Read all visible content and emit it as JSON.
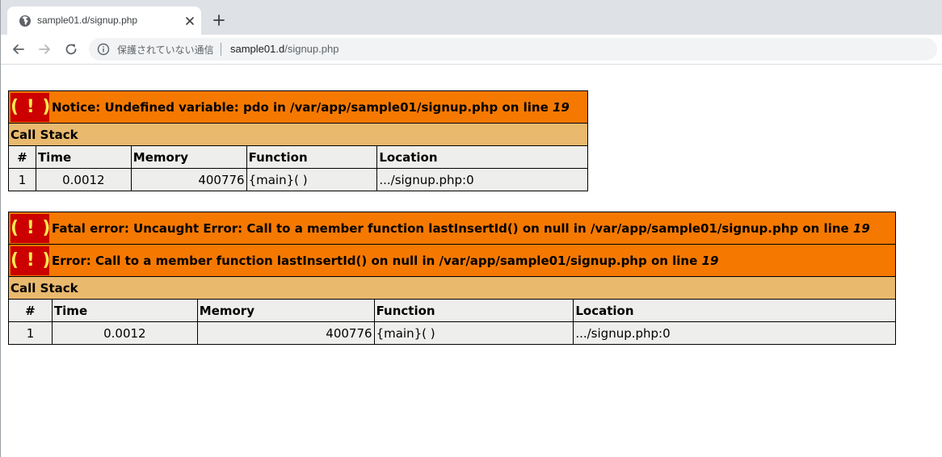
{
  "browser": {
    "tab_title": "sample01.d/signup.php",
    "security_label": "保護されていない通信",
    "url_host": "sample01.d",
    "url_path": "/signup.php"
  },
  "colors": {
    "error_header": "#f57900",
    "call_stack_header": "#e9b96e",
    "cell_background": "#eeeeec",
    "icon_background": "#cc0000",
    "icon_glyph": "#fce94f"
  },
  "errors": [
    {
      "icon_text": "( ! )",
      "messages": [
        {
          "text": "Notice: Undefined variable: pdo in /var/app/sample01/signup.php on line ",
          "line": "19"
        }
      ],
      "call_stack_label": "Call Stack",
      "columns": [
        "#",
        "Time",
        "Memory",
        "Function",
        "Location"
      ],
      "rows": [
        {
          "num": "1",
          "time": "0.0012",
          "memory": "400776",
          "function": "{main}( )",
          "location": ".../signup.php:0"
        }
      ]
    },
    {
      "icon_text": "( ! )",
      "messages": [
        {
          "text": "Fatal error: Uncaught Error: Call to a member function lastInsertId() on null in /var/app/sample01/signup.php on line ",
          "line": "19"
        },
        {
          "text": "Error: Call to a member function lastInsertId() on null in /var/app/sample01/signup.php on line ",
          "line": "19"
        }
      ],
      "call_stack_label": "Call Stack",
      "columns": [
        "#",
        "Time",
        "Memory",
        "Function",
        "Location"
      ],
      "rows": [
        {
          "num": "1",
          "time": "0.0012",
          "memory": "400776",
          "function": "{main}( )",
          "location": ".../signup.php:0"
        }
      ]
    }
  ]
}
